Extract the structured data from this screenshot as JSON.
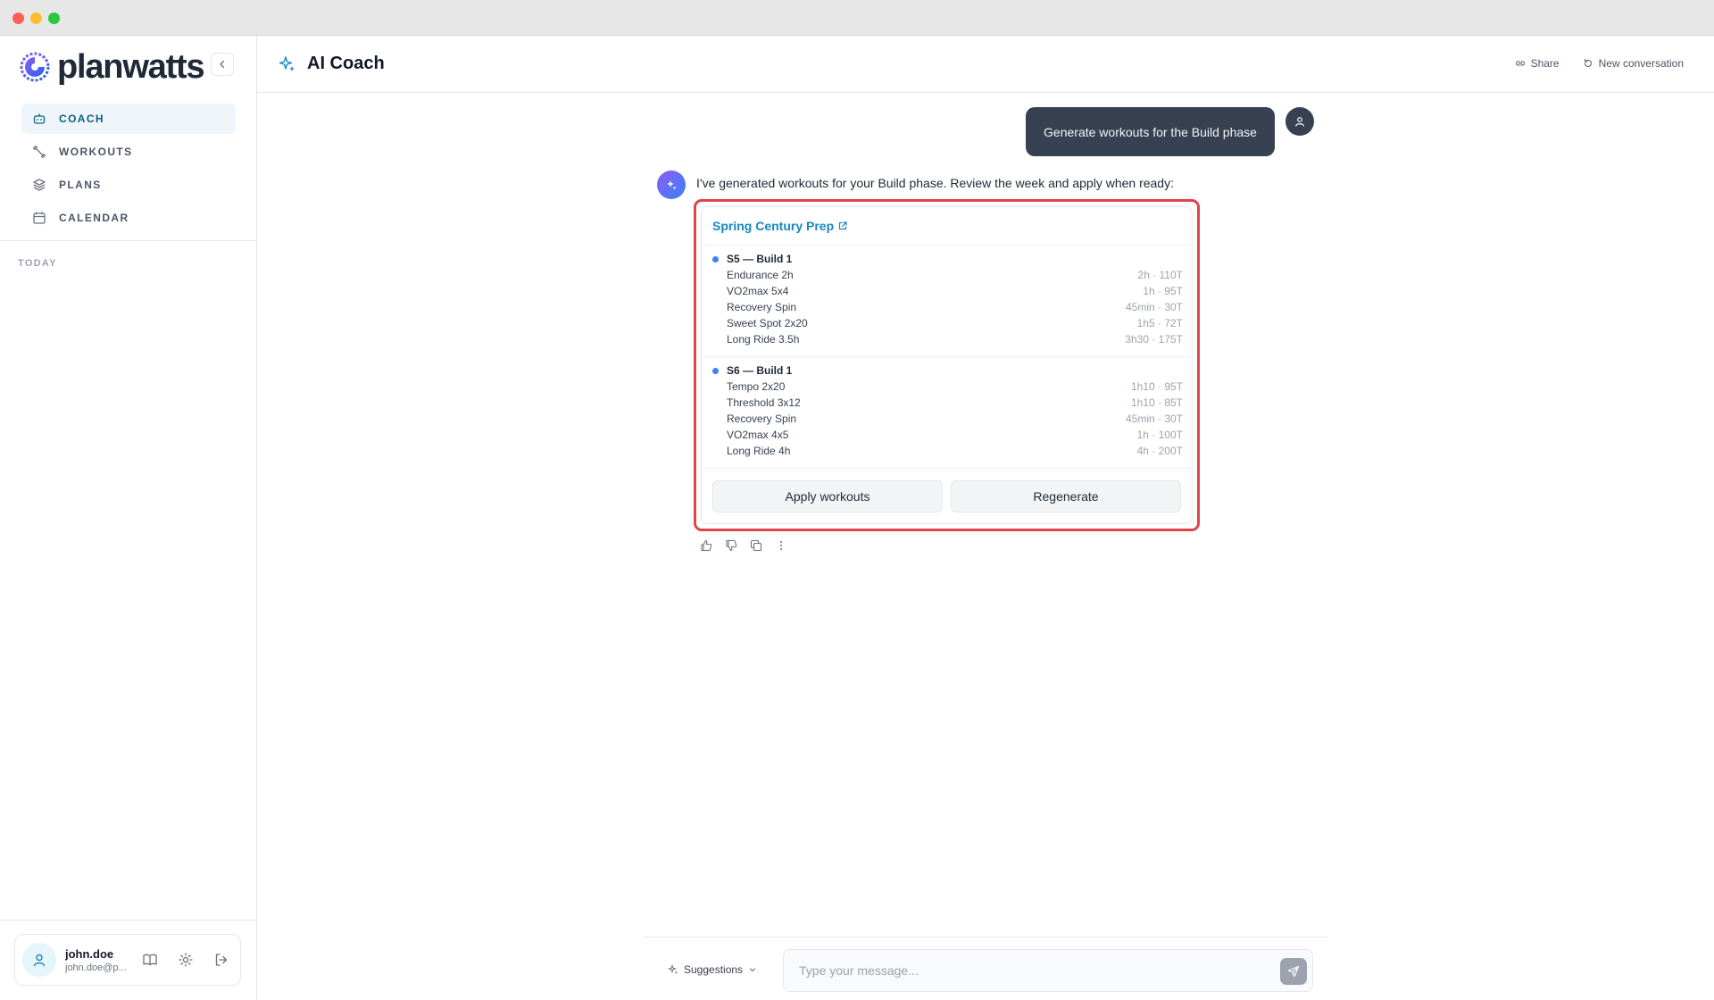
{
  "brand": {
    "name": "planwatts"
  },
  "sidebar": {
    "items": [
      {
        "label": "COACH",
        "icon": "bot-icon",
        "active": true
      },
      {
        "label": "WORKOUTS",
        "icon": "dumbbell-icon",
        "active": false
      },
      {
        "label": "PLANS",
        "icon": "layers-icon",
        "active": false
      },
      {
        "label": "CALENDAR",
        "icon": "calendar-icon",
        "active": false
      }
    ],
    "section_label": "TODAY"
  },
  "user": {
    "name": "john.doe",
    "email": "john.doe@p..."
  },
  "header": {
    "title": "AI Coach",
    "share_label": "Share",
    "new_conversation_label": "New conversation"
  },
  "chat": {
    "user_message": "Generate workouts for the Build phase",
    "assistant_intro": "I've generated workouts for your Build phase. Review the week and apply when ready:",
    "plan": {
      "name": "Spring Century Prep",
      "weeks": [
        {
          "title": "S5 — Build 1",
          "workouts": [
            {
              "name": "Endurance 2h",
              "meta": "2h · 110T"
            },
            {
              "name": "VO2max 5x4",
              "meta": "1h · 95T"
            },
            {
              "name": "Recovery Spin",
              "meta": "45min · 30T"
            },
            {
              "name": "Sweet Spot 2x20",
              "meta": "1h5 · 72T"
            },
            {
              "name": "Long Ride 3.5h",
              "meta": "3h30 · 175T"
            }
          ]
        },
        {
          "title": "S6 — Build 1",
          "workouts": [
            {
              "name": "Tempo 2x20",
              "meta": "1h10 · 95T"
            },
            {
              "name": "Threshold 3x12",
              "meta": "1h10 · 85T"
            },
            {
              "name": "Recovery Spin",
              "meta": "45min · 30T"
            },
            {
              "name": "VO2max 4x5",
              "meta": "1h · 100T"
            },
            {
              "name": "Long Ride 4h",
              "meta": "4h · 200T"
            }
          ]
        }
      ],
      "apply_label": "Apply workouts",
      "regenerate_label": "Regenerate"
    }
  },
  "composer": {
    "suggestions_label": "Suggestions",
    "placeholder": "Type your message..."
  },
  "colors": {
    "accent": "#1588c0",
    "highlight": "#e0434b",
    "user_bubble": "#374151",
    "week_dot": "#3b82f6"
  }
}
